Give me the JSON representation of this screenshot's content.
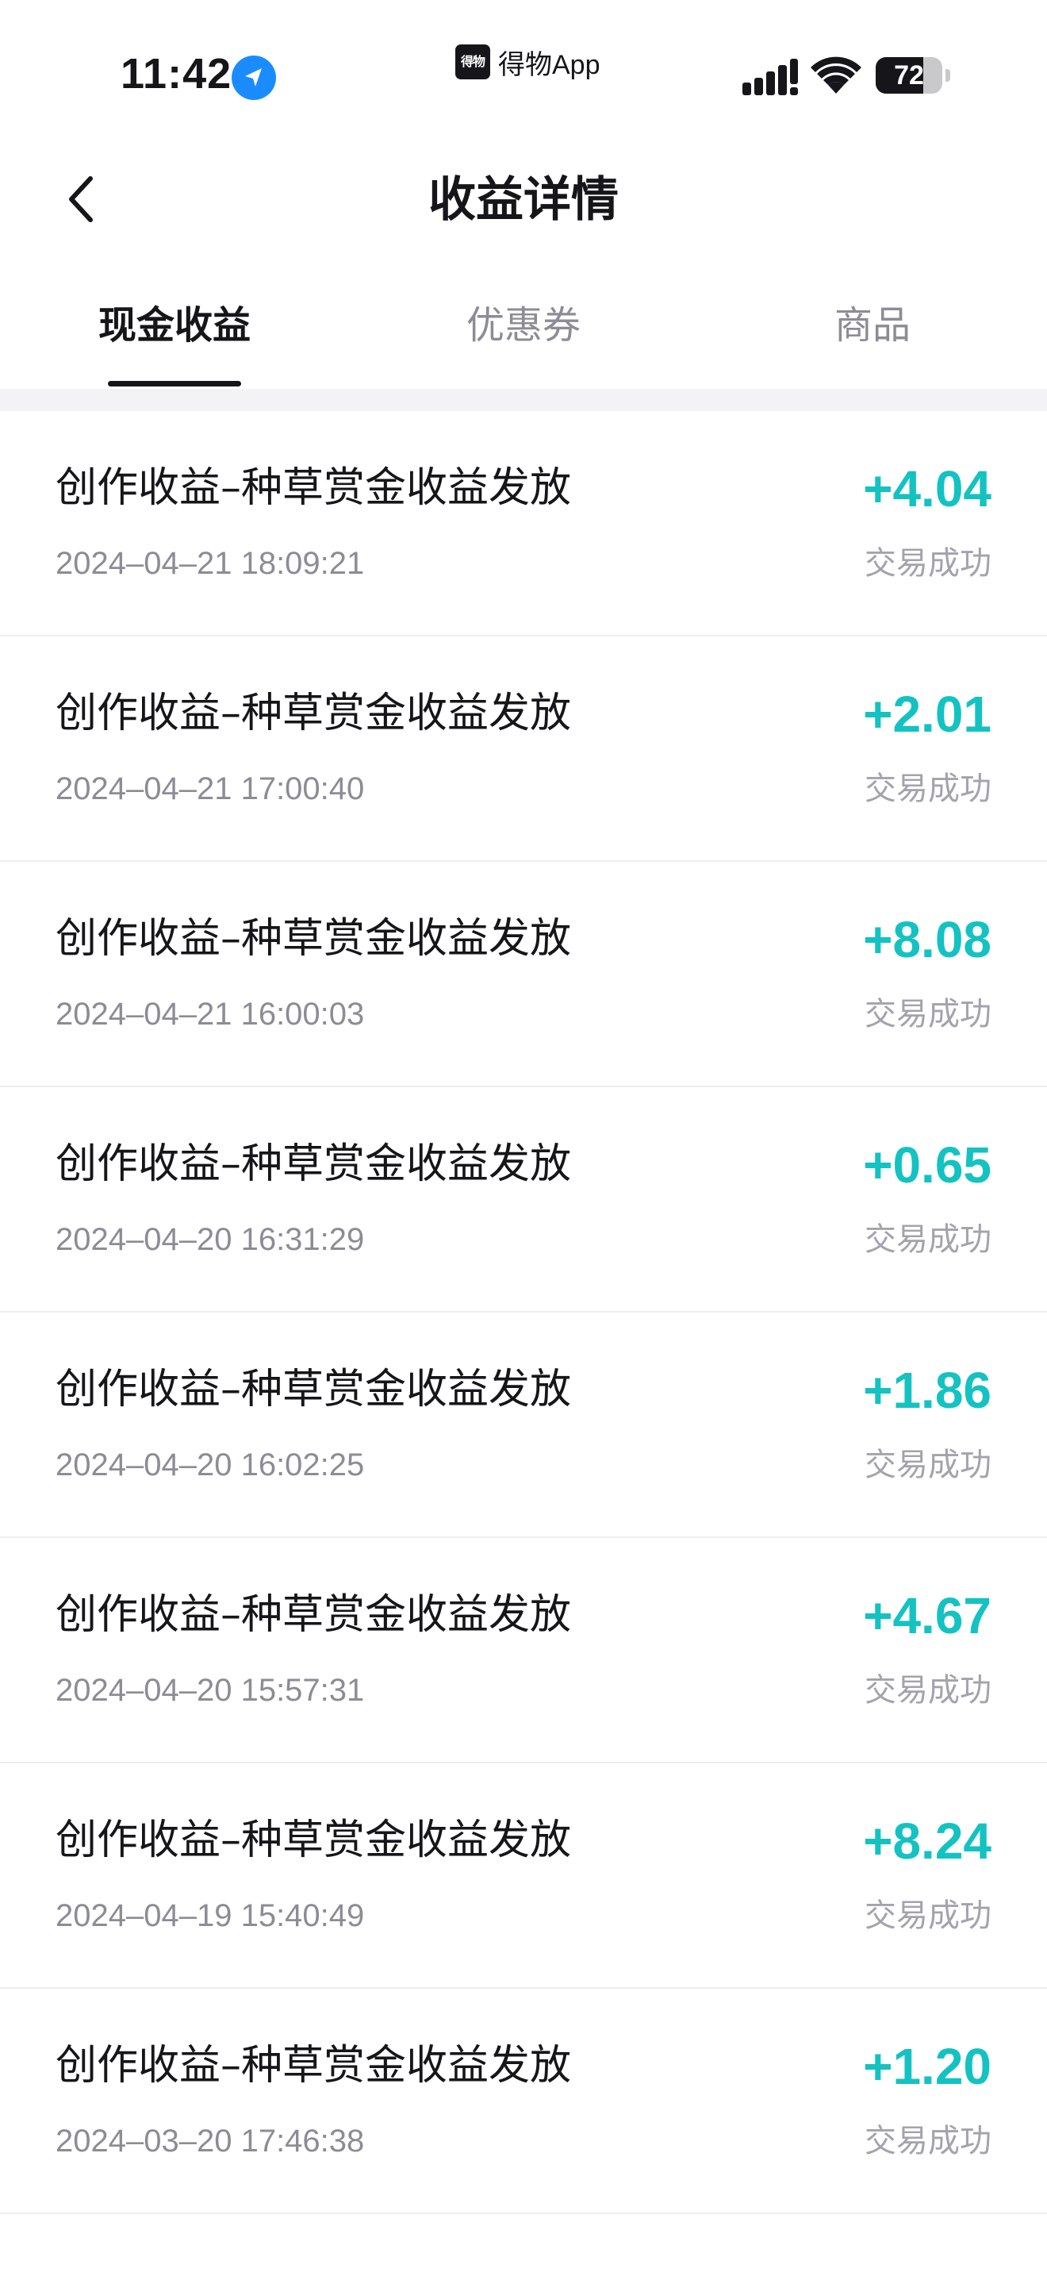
{
  "status_bar": {
    "time": "11:42",
    "app_name": "得物App",
    "app_logo_text": "得物",
    "battery": "72",
    "battery_level": 0.72
  },
  "nav": {
    "title": "收益详情",
    "back_icon": "chevron-left-icon"
  },
  "tabs": [
    {
      "label": "现金收益",
      "active": true
    },
    {
      "label": "优惠券",
      "active": false
    },
    {
      "label": "商品",
      "active": false
    }
  ],
  "colors": {
    "accent_amount": "#14c2c2",
    "primary_text": "#16161a",
    "secondary_text": "#8c8c96",
    "location_blue": "#1a8cff"
  },
  "transactions": [
    {
      "title": "创作收益–种草赏金收益发放",
      "date": "2024–04–21 18:09:21",
      "amount": "+4.04",
      "status": "交易成功"
    },
    {
      "title": "创作收益–种草赏金收益发放",
      "date": "2024–04–21 17:00:40",
      "amount": "+2.01",
      "status": "交易成功"
    },
    {
      "title": "创作收益–种草赏金收益发放",
      "date": "2024–04–21 16:00:03",
      "amount": "+8.08",
      "status": "交易成功"
    },
    {
      "title": "创作收益–种草赏金收益发放",
      "date": "2024–04–20 16:31:29",
      "amount": "+0.65",
      "status": "交易成功"
    },
    {
      "title": "创作收益–种草赏金收益发放",
      "date": "2024–04–20 16:02:25",
      "amount": "+1.86",
      "status": "交易成功"
    },
    {
      "title": "创作收益–种草赏金收益发放",
      "date": "2024–04–20 15:57:31",
      "amount": "+4.67",
      "status": "交易成功"
    },
    {
      "title": "创作收益–种草赏金收益发放",
      "date": "2024–04–19 15:40:49",
      "amount": "+8.24",
      "status": "交易成功"
    },
    {
      "title": "创作收益–种草赏金收益发放",
      "date": "2024–03–20 17:46:38",
      "amount": "+1.20",
      "status": "交易成功"
    }
  ]
}
